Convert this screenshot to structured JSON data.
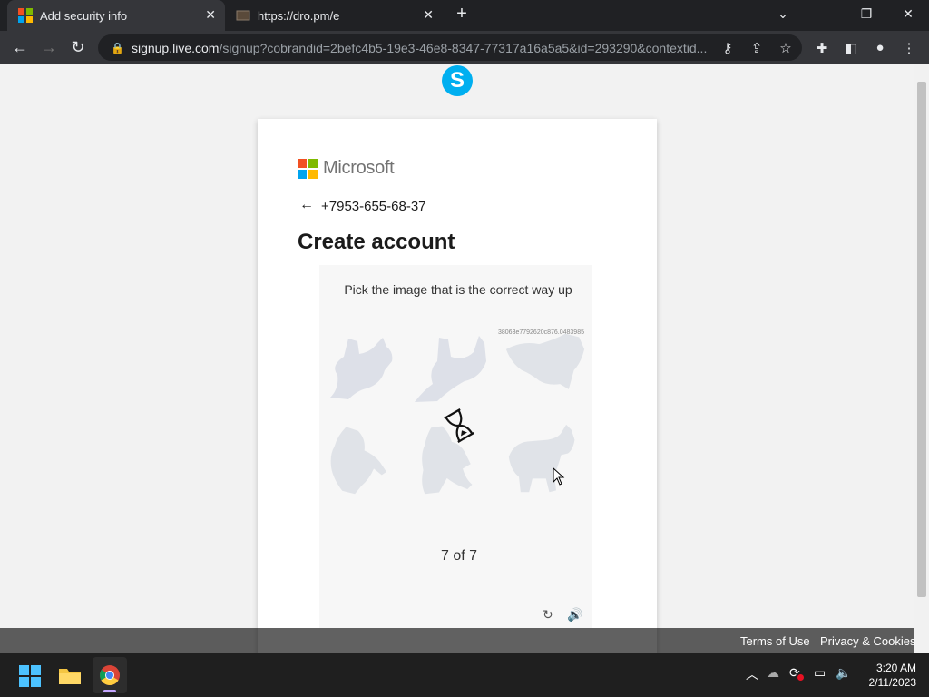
{
  "browser": {
    "tabs": [
      {
        "title": "Add security info",
        "active": true
      },
      {
        "title": "https://dro.pm/e",
        "active": false
      }
    ],
    "url_host": "signup.live.com",
    "url_path": "/signup?cobrandid=2befc4b5-19e3-46e8-8347-77317a16a5a5&id=293290&contextid..."
  },
  "page": {
    "brand": "Microsoft",
    "identity": "+7953-655-68-37",
    "title": "Create account",
    "puzzle": {
      "prompt": "Pick the image that is the correct way up",
      "session_id": "38063e7792620c876.0483985",
      "counter": "7 of 7"
    },
    "footer": {
      "terms": "Terms of Use",
      "privacy": "Privacy & Cookies"
    }
  },
  "taskbar": {
    "time": "3:20 AM",
    "date": "2/11/2023"
  },
  "colors": {
    "skype": "#00aff0",
    "ms_red": "#f25022",
    "ms_green": "#7fba00",
    "ms_blue": "#00a4ef",
    "ms_yellow": "#ffb900"
  }
}
